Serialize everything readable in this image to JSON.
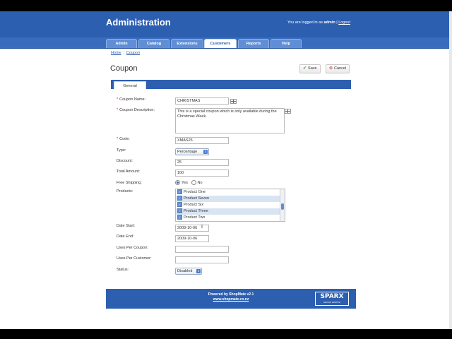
{
  "header": {
    "title": "Administration",
    "login_prefix": "You are logged in as",
    "user": "admin",
    "separator": "|",
    "logout": "Logout"
  },
  "tabs": [
    {
      "label": "Admin"
    },
    {
      "label": "Catalog"
    },
    {
      "label": "Extensions"
    },
    {
      "label": "Customers",
      "active": true
    },
    {
      "label": "Reports"
    },
    {
      "label": "Help"
    }
  ],
  "breadcrumb": {
    "home": "Home",
    "separator": "::",
    "current": "Coupon"
  },
  "page": {
    "title": "Coupon",
    "save_label": "Save",
    "cancel_label": "Cancel"
  },
  "form_tab": "General",
  "form": {
    "coupon_name_label": "Coupon Name:",
    "coupon_name_value": "CHRISTMAS",
    "coupon_description_label": "Coupon Description:",
    "coupon_description_value": "This is a special coupon which is only available during the Christmas Week.",
    "code_label": "Code:",
    "code_value": "XMAS25",
    "type_label": "Type:",
    "type_value": "Percentage",
    "discount_label": "Discount:",
    "discount_value": "25",
    "total_amount_label": "Total Amount:",
    "total_amount_value": "100",
    "free_shipping_label": "Free Shipping:",
    "free_shipping_yes": "Yes",
    "free_shipping_no": "No",
    "free_shipping_selected": "Yes",
    "products_label": "Products:",
    "products": [
      "Product One",
      "Product Seven",
      "Product Six",
      "Product Three",
      "Product Two"
    ],
    "date_start_label": "Date Start:",
    "date_start_value": "2009-10-06",
    "date_end_label": "Date End:",
    "date_end_value": "2009-10-06",
    "uses_per_coupon_label": "Uses Per Coupon:",
    "uses_per_coupon_value": "",
    "uses_per_customer_label": "Uses Per Customer:",
    "uses_per_customer_value": "",
    "status_label": "Status:",
    "status_value": "Disabled"
  },
  "footer": {
    "powered_by": "Powered by ShopMate v2.1",
    "url": "www.shopmate.co.nz",
    "logo_text": "SPARX",
    "logo_sub": "GROUP LIMITED"
  },
  "colors": {
    "header_blue": "#2d5fb0",
    "required_star": "#d02020"
  }
}
